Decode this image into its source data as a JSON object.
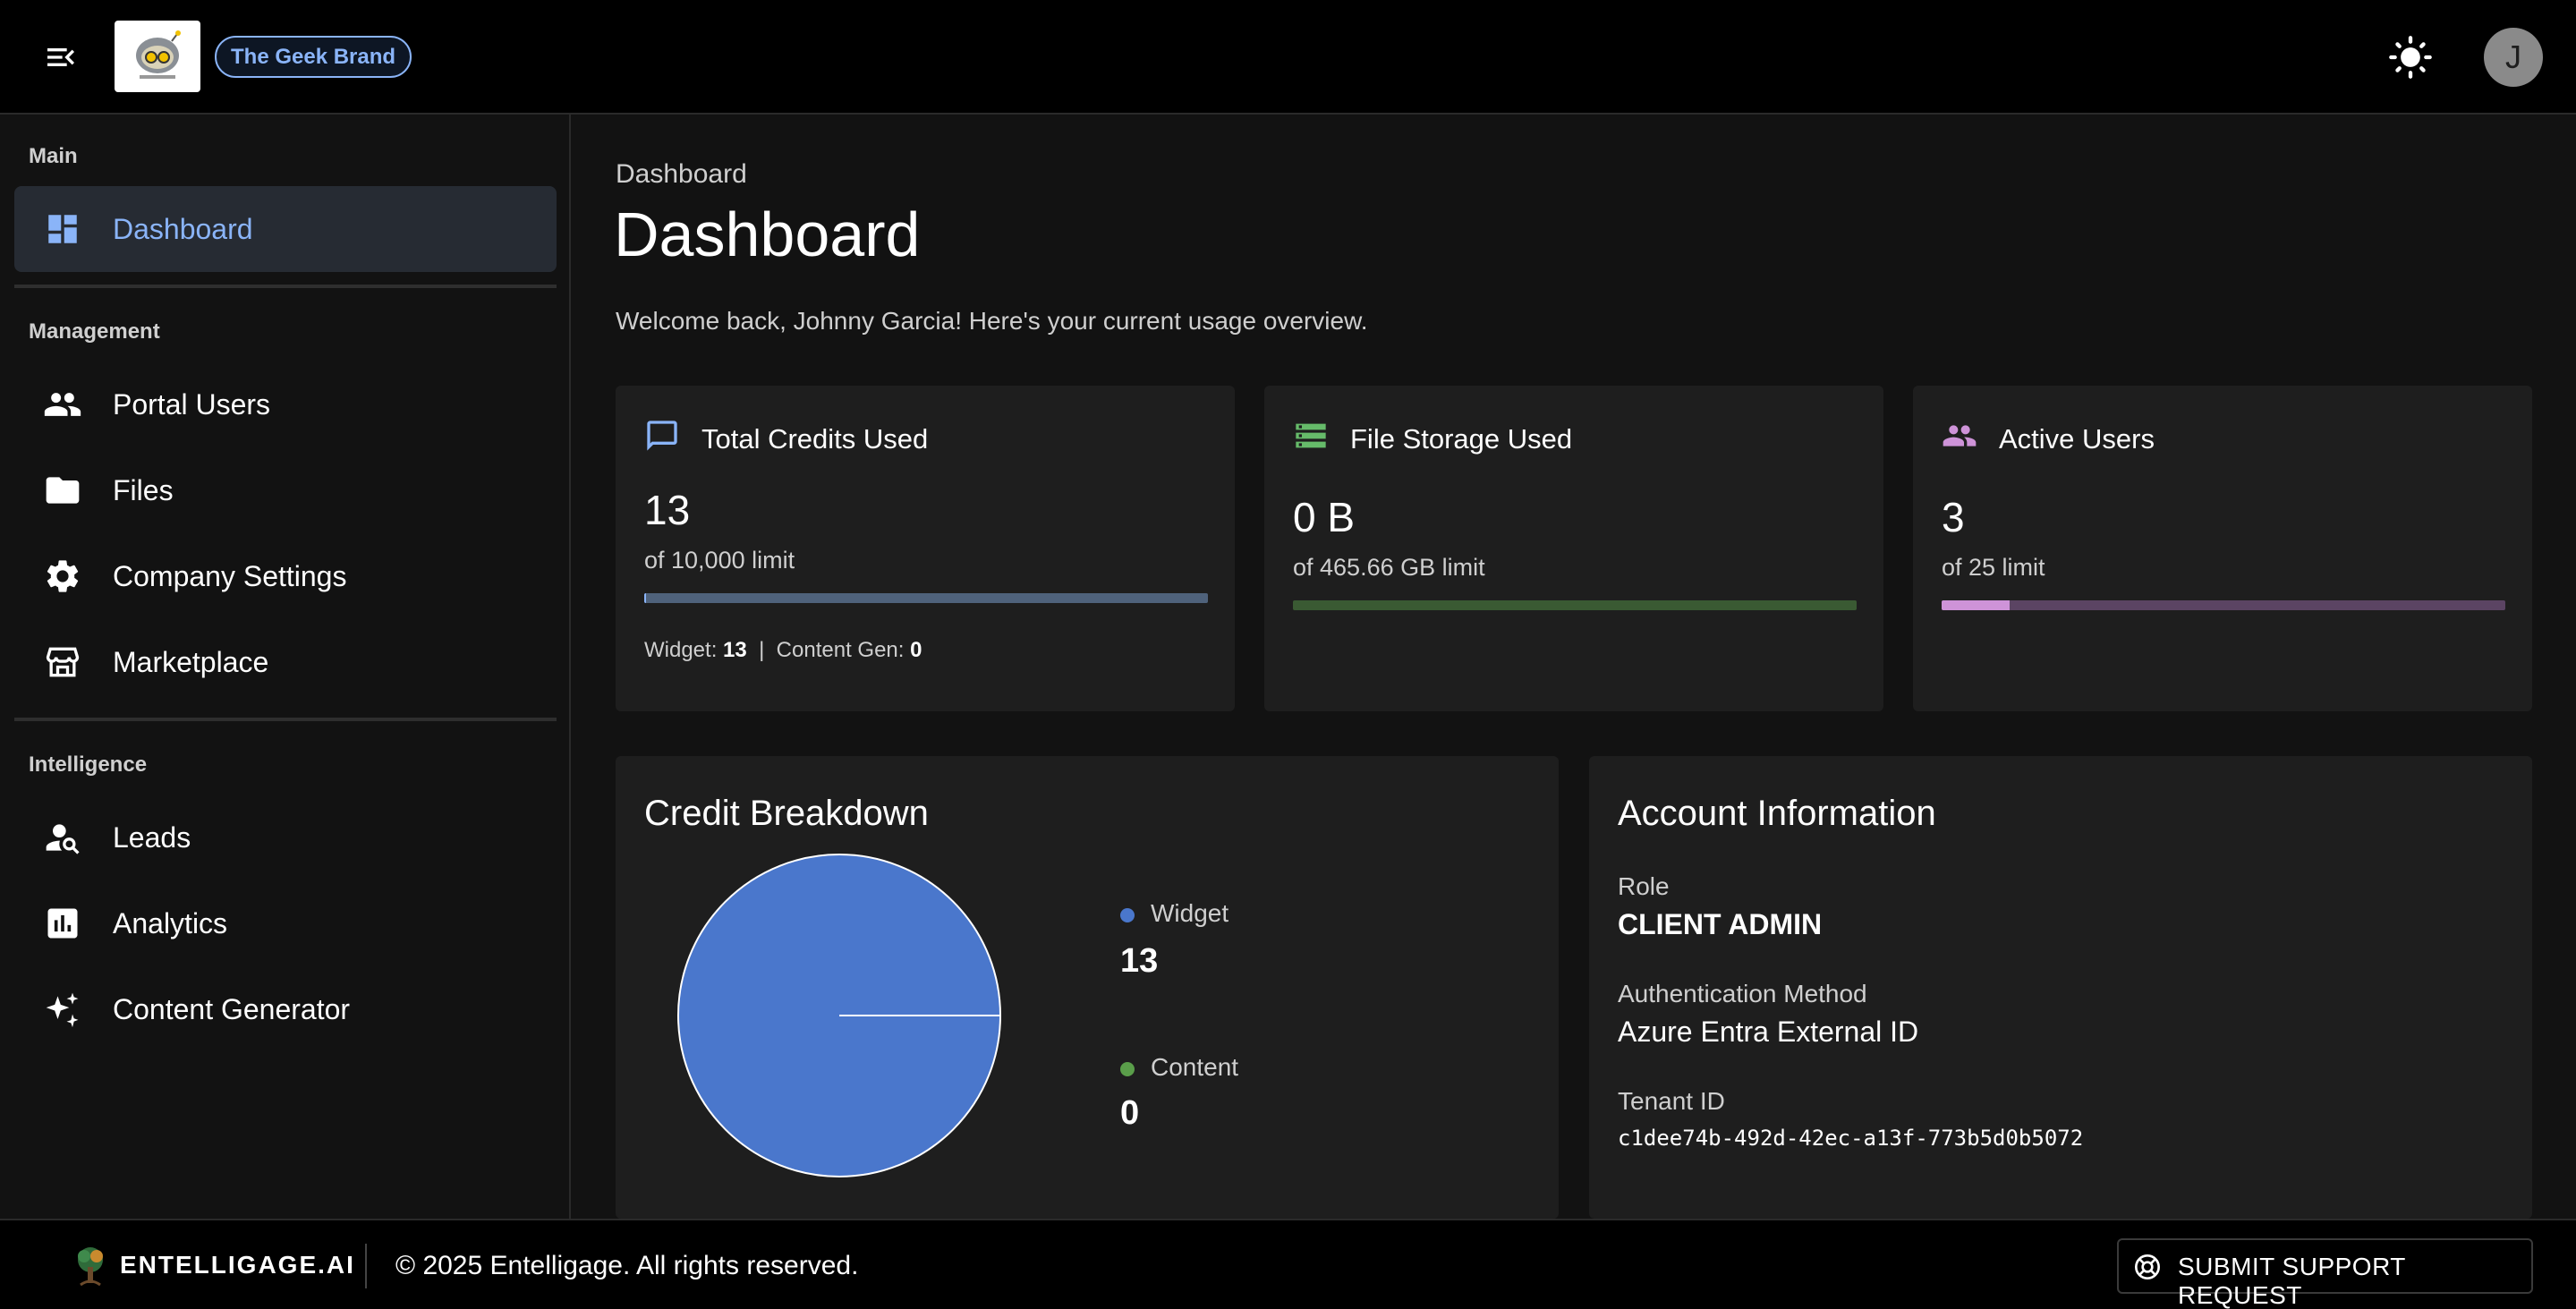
{
  "header": {
    "menu_icon": "menu-collapse-icon",
    "logo_alt": "The Geek Brand logo",
    "brand_chip": "The Geek Brand",
    "theme_icon": "sun-icon",
    "avatar_initial": "J"
  },
  "sidebar": {
    "sections": [
      {
        "title": "Main"
      },
      {
        "title": "Management"
      },
      {
        "title": "Intelligence"
      }
    ],
    "items": [
      {
        "label": "Dashboard",
        "icon": "dashboard-icon",
        "active": true
      },
      {
        "label": "Portal Users",
        "icon": "people-icon"
      },
      {
        "label": "Files",
        "icon": "folder-icon"
      },
      {
        "label": "Company Settings",
        "icon": "gear-icon"
      },
      {
        "label": "Marketplace",
        "icon": "storefront-icon"
      },
      {
        "label": "Leads",
        "icon": "person-search-icon"
      },
      {
        "label": "Analytics",
        "icon": "analytics-icon"
      },
      {
        "label": "Content Generator",
        "icon": "sparkle-icon"
      }
    ]
  },
  "main": {
    "breadcrumb": "Dashboard",
    "title": "Dashboard",
    "welcome": "Welcome back, Johnny Garcia! Here's your current usage overview.",
    "cards": {
      "credits": {
        "title": "Total Credits Used",
        "icon": "chat-icon",
        "value": "13",
        "limit_text": "of 10,000 limit",
        "progress": 0.0013,
        "widget_label": "Widget:",
        "widget_value": "13",
        "sep": "|",
        "content_label": "Content Gen:",
        "content_value": "0",
        "color": "#8ab4f8"
      },
      "storage": {
        "title": "File Storage Used",
        "icon": "storage-icon",
        "value": "0 B",
        "limit_text": "of 465.66 GB limit",
        "progress": 0,
        "color": "#66bb6a"
      },
      "users": {
        "title": "Active Users",
        "icon": "group-icon",
        "value": "3",
        "limit_text": "of 25 limit",
        "progress": 0.12,
        "color": "#ce93d8"
      }
    },
    "credit_breakdown": {
      "title": "Credit Breakdown",
      "legend": [
        {
          "label": "Widget",
          "value": "13",
          "color": "#4a77cc"
        },
        {
          "label": "Content",
          "value": "0",
          "color": "#5a9e4a"
        }
      ]
    },
    "account": {
      "title": "Account Information",
      "role_label": "Role",
      "role_value": "CLIENT ADMIN",
      "auth_label": "Authentication Method",
      "auth_value": "Azure Entra External ID",
      "tenant_label": "Tenant ID",
      "tenant_value": "c1dee74b-492d-42ec-a13f-773b5d0b5072"
    }
  },
  "chart_data": {
    "type": "pie",
    "title": "Credit Breakdown",
    "categories": [
      "Widget",
      "Content"
    ],
    "values": [
      13,
      0
    ],
    "colors": [
      "#4a77cc",
      "#5a9e4a"
    ]
  },
  "footer": {
    "brand": "ENTELLIGAGE.AI",
    "copyright": "© 2025 Entelligage. All rights reserved.",
    "support_button": "SUBMIT SUPPORT REQUEST",
    "support_icon": "lifebuoy-icon"
  }
}
